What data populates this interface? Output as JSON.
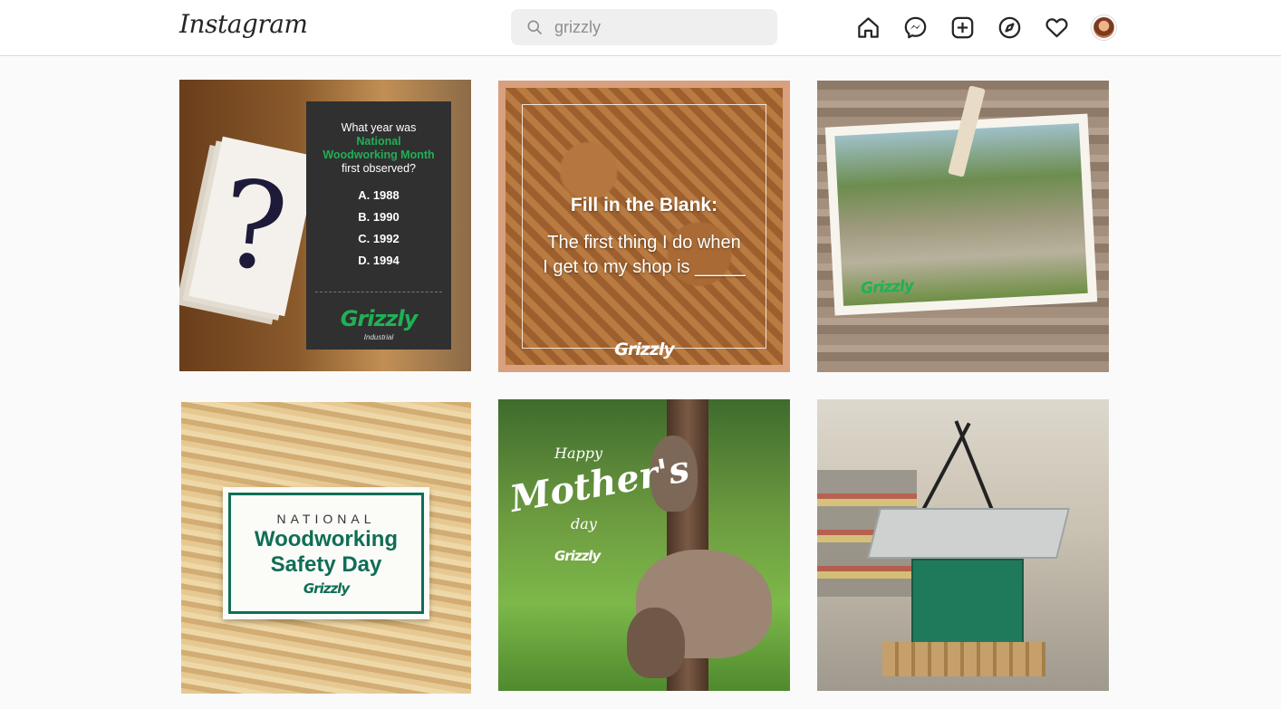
{
  "header": {
    "logo": "Instagram",
    "search": {
      "value": "grizzly",
      "placeholder": "Search"
    },
    "nav_icons": [
      "home-icon",
      "messenger-icon",
      "new-post-icon",
      "explore-icon",
      "activity-heart-icon",
      "profile-avatar"
    ]
  },
  "posts": [
    {
      "question": "What year was",
      "highlight_1": "National",
      "highlight_2": "Woodworking Month",
      "question_end": "first observed?",
      "options": [
        "A.  1988",
        "B.  1990",
        "C.  1992",
        "D.  1994"
      ],
      "brand": "Grizzly",
      "brand_sub": "Industrial"
    },
    {
      "title": "Fill in the Blank:",
      "body": "The first thing I do when\nI get to my shop is _____",
      "brand": "Grizzly"
    },
    {
      "brand": "Grizzly"
    },
    {
      "line1": "NATIONAL",
      "line2": "Woodworking",
      "line3": "Safety Day",
      "brand": "Grizzly"
    },
    {
      "happy": "Happy",
      "mothers": "Mother's",
      "day": "day",
      "brand": "Grizzly"
    },
    {}
  ],
  "colors": {
    "accent_green": "#1fb155",
    "border": "#dbdbdb",
    "background": "#fafafa"
  }
}
